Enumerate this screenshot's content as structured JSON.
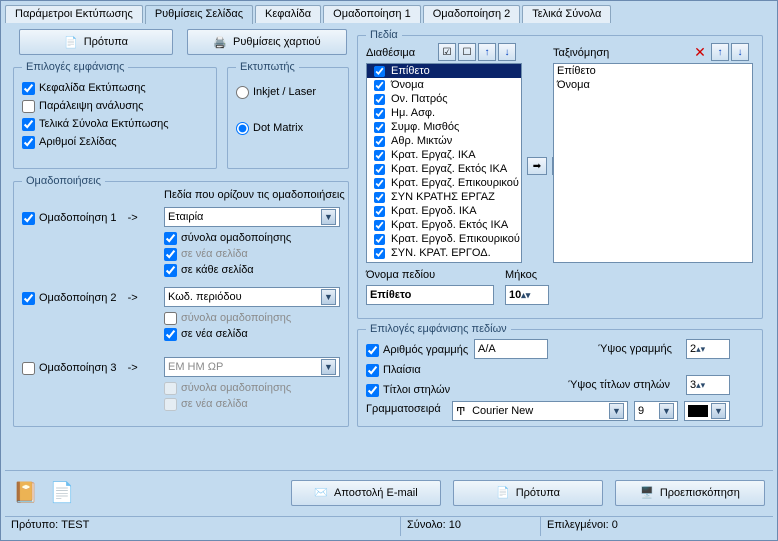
{
  "tabs": [
    {
      "label": "Παράμετροι Εκτύπωσης"
    },
    {
      "label": "Ρυθμίσεις Σελίδας"
    },
    {
      "label": "Κεφαλίδα"
    },
    {
      "label": "Ομαδοποίηση 1"
    },
    {
      "label": "Ομαδοποίηση 2"
    },
    {
      "label": "Τελικά Σύνολα"
    }
  ],
  "topbtns": {
    "templates": "Πρότυπα",
    "paper": "Ρυθμίσεις χαρτιού"
  },
  "display_opts": {
    "legend": "Επιλογές εμφάνισης",
    "h": "Κεφαλίδα Εκτύπωσης",
    "skip": "Παράλειψη ανάλυσης",
    "totals": "Τελικά Σύνολα Εκτύπωσης",
    "nums": "Αριθμοί Σελίδας"
  },
  "printer": {
    "legend": "Εκτυπωτής",
    "inkjet": "Inkjet / Laser",
    "dm": "Dot Matrix"
  },
  "groupings": {
    "legend": "Ομαδοποιήσεις",
    "fieldshdr": "Πεδία που ορίζουν τις ομαδοποιήσεις",
    "g1": "Ομαδοποίηση 1",
    "g2": "Ομαδοποίηση 2",
    "g3": "Ομαδοποίηση 3",
    "arrow": "->",
    "c1": "Εταιρία",
    "c2": "Κωδ. περιόδου",
    "c3": "ΕΜ ΗΜ ΩΡ",
    "sub": "σύνολα ομαδοποίησης",
    "np": "σε νέα σελίδα",
    "ep": "σε κάθε σελίδα"
  },
  "fields": {
    "legend": "Πεδία",
    "avail": "Διαθέσιμα",
    "sort": "Ταξινόμηση",
    "items": [
      "Επίθετο",
      "Όνομα",
      "Ον. Πατρός",
      "Ημ. Ασφ.",
      "Συμφ. Μισθός",
      "Αθρ. Μικτών",
      "Κρατ. Εργαζ. ΙΚΑ",
      "Κρατ. Εργαζ. Εκτός ΙΚΑ",
      "Κρατ. Εργαζ. Επικουρικού",
      "ΣΥΝ ΚΡΑΤΗΣ ΕΡΓΑΖ",
      "Κρατ. Εργοδ. ΙΚΑ",
      "Κρατ. Εργοδ. Εκτός ΙΚΑ",
      "Κρατ. Εργοδ. Επικουρικού",
      "ΣΥΝ. ΚΡΑΤ. ΕΡΓΟΔ."
    ],
    "sortitems": [
      "Επίθετο",
      "Όνομα"
    ],
    "fname": "Όνομα πεδίου",
    "flen": "Μήκος",
    "fname_val": "Επίθετο",
    "flen_val": "10"
  },
  "fieldopts": {
    "legend": "Επιλογές εμφάνισης πεδίων",
    "rownum": "Αριθμός γραμμής",
    "rownum_val": "Α/Α",
    "frames": "Πλαίσια",
    "coltitles": "Τίτλοι στηλών",
    "rowh": "Ύψος γραμμής",
    "rowh_val": "2",
    "titleh": "Ύψος τίτλων στηλών",
    "titleh_val": "3",
    "font": "Γραμματοσειρά",
    "font_val": "Courier New",
    "font_size": "9"
  },
  "bottombtns": {
    "email": "Αποστολή E-mail",
    "templates": "Πρότυπα",
    "preview": "Προεπισκόπηση"
  },
  "status": {
    "a": "Πρότυπο: TEST",
    "b": "Σύνολο: 10",
    "c": "Επιλεγμένοι: 0"
  }
}
